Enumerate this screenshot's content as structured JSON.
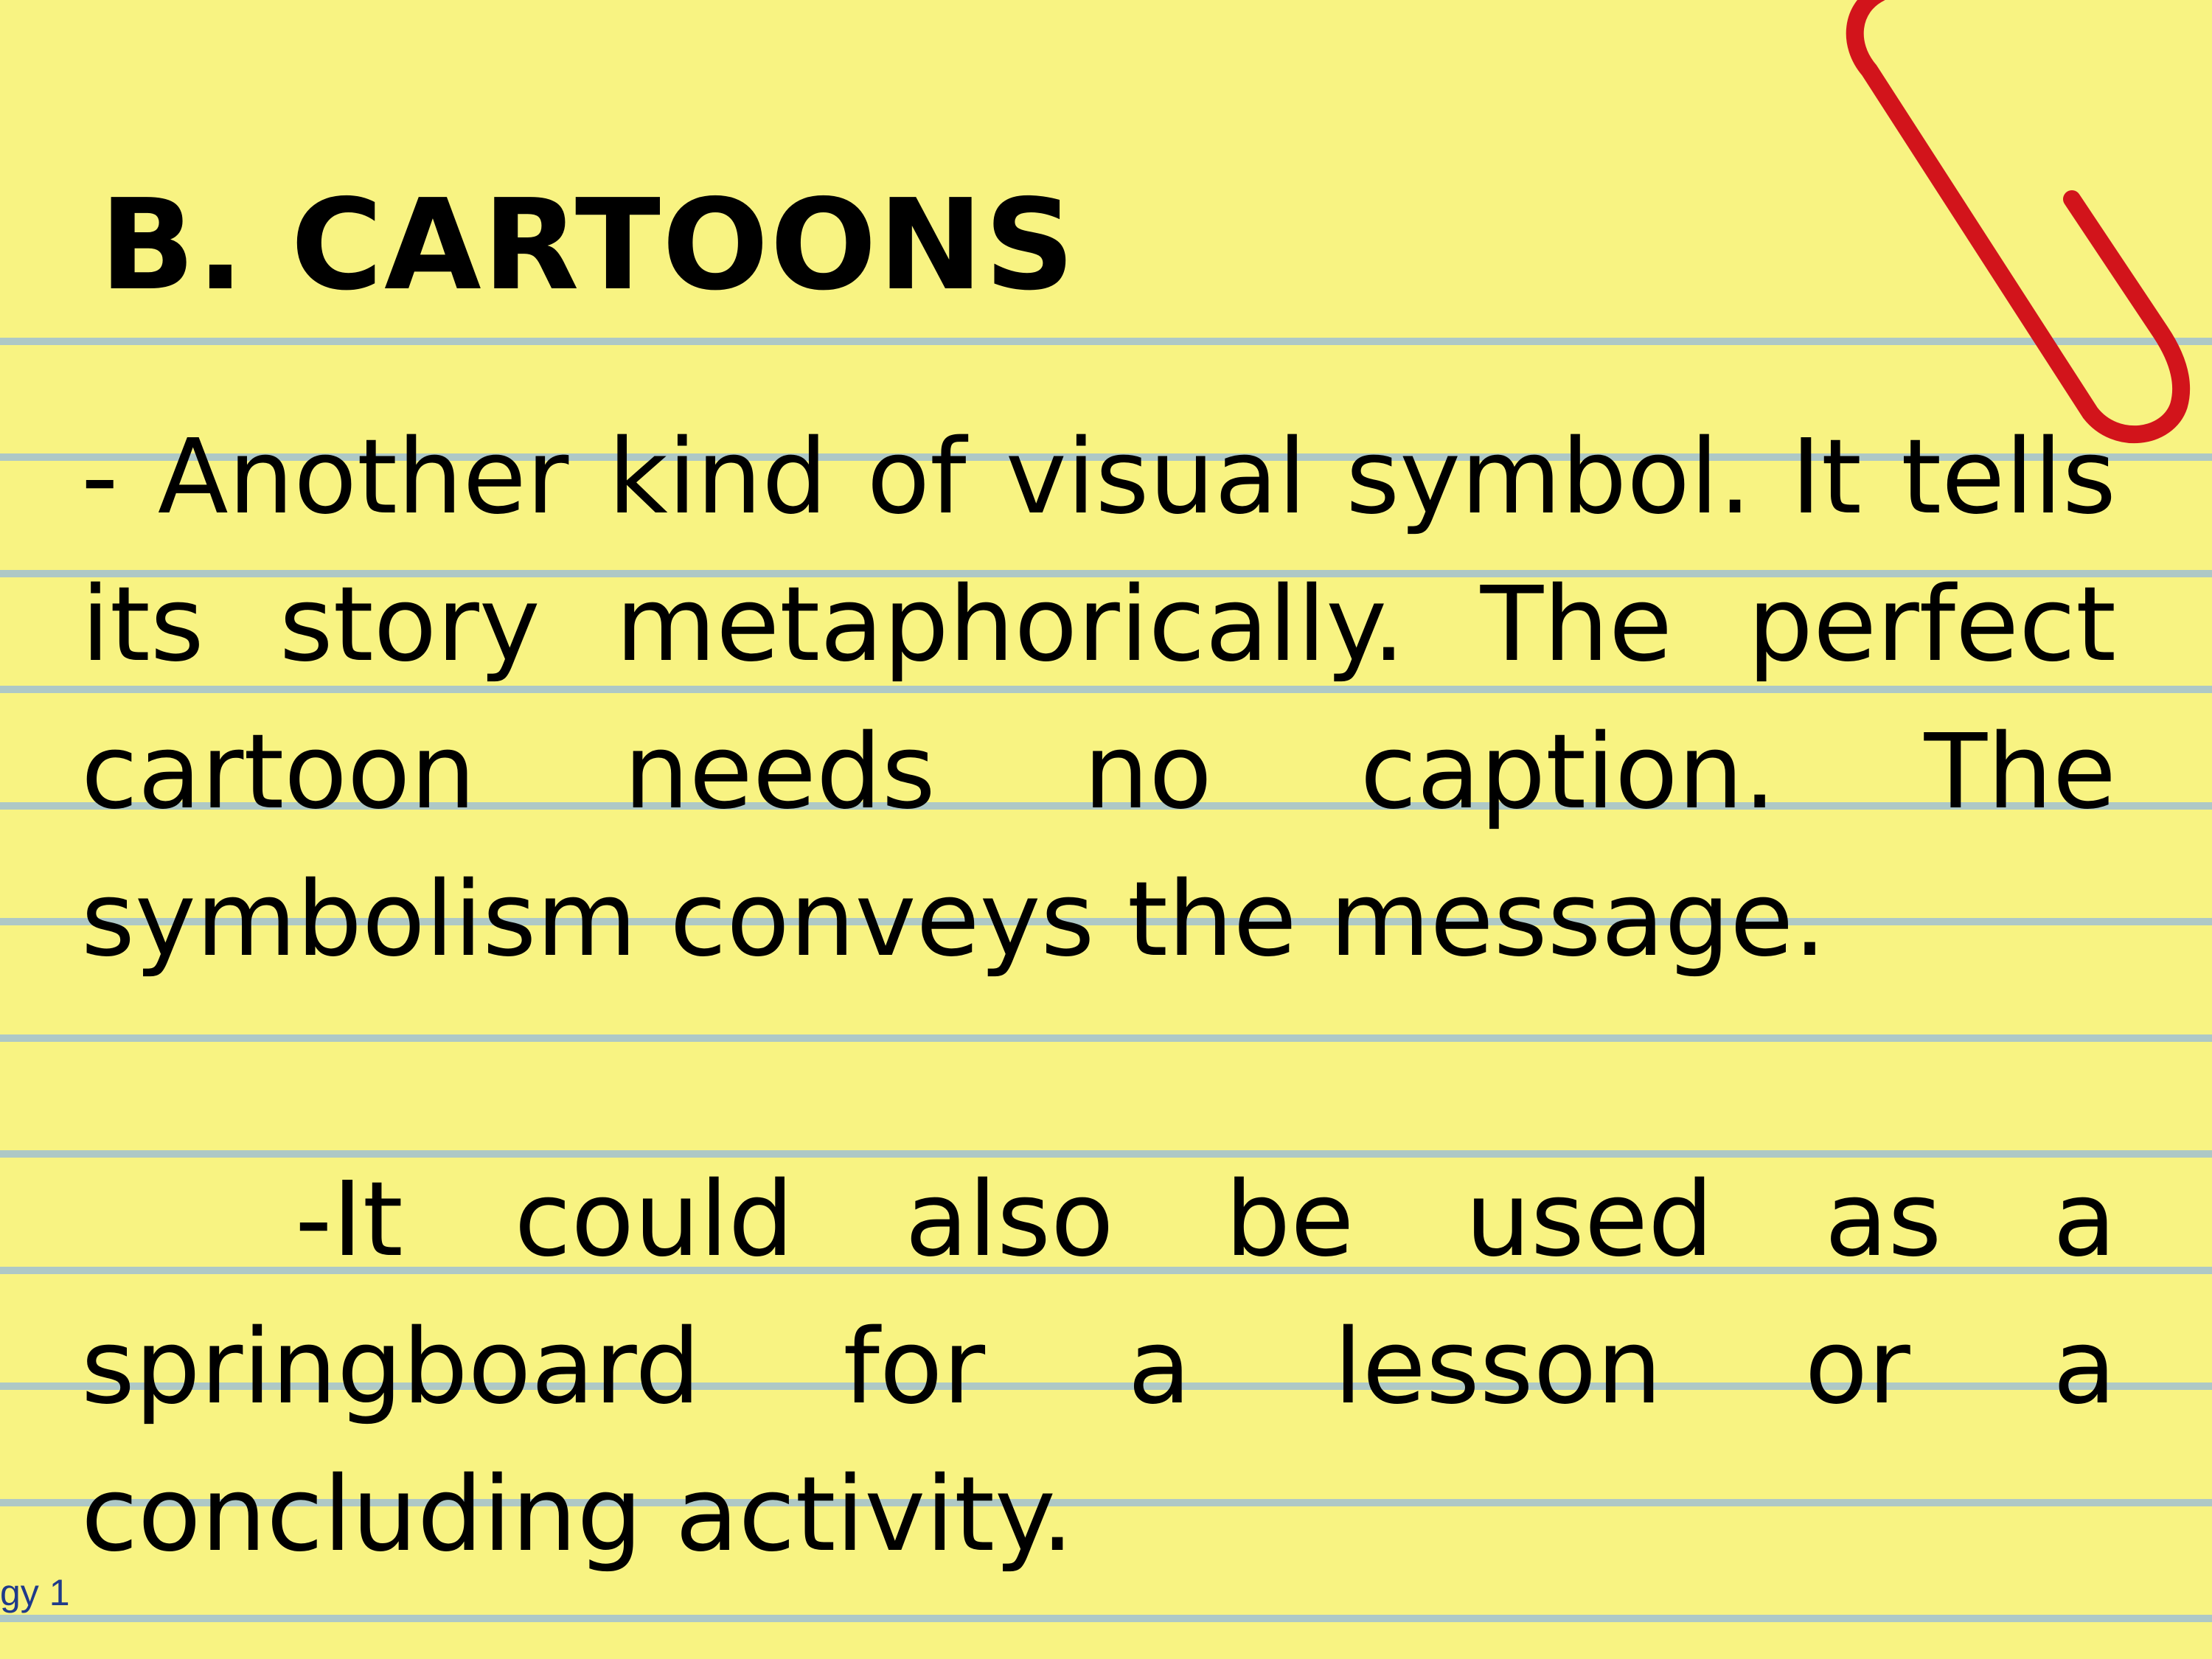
{
  "slide": {
    "heading": "B. CARTOONS",
    "paragraph_1": "- Another kind of visual symbol. It tells its story metaphorically. The perfect cartoon needs no caption. The symbolism conveys the message.",
    "paragraph_2": "-It could also be used as a springboard for a lesson or a concluding activity.",
    "footer_fragment": "gy 1"
  },
  "colors": {
    "paper": "#f8f382",
    "rule_lines": "#aec8c6",
    "text": "#000000",
    "paperclip": "#d2141b",
    "footer_text": "#1f3a8a"
  },
  "icons": {
    "paperclip": "paperclip-icon"
  }
}
